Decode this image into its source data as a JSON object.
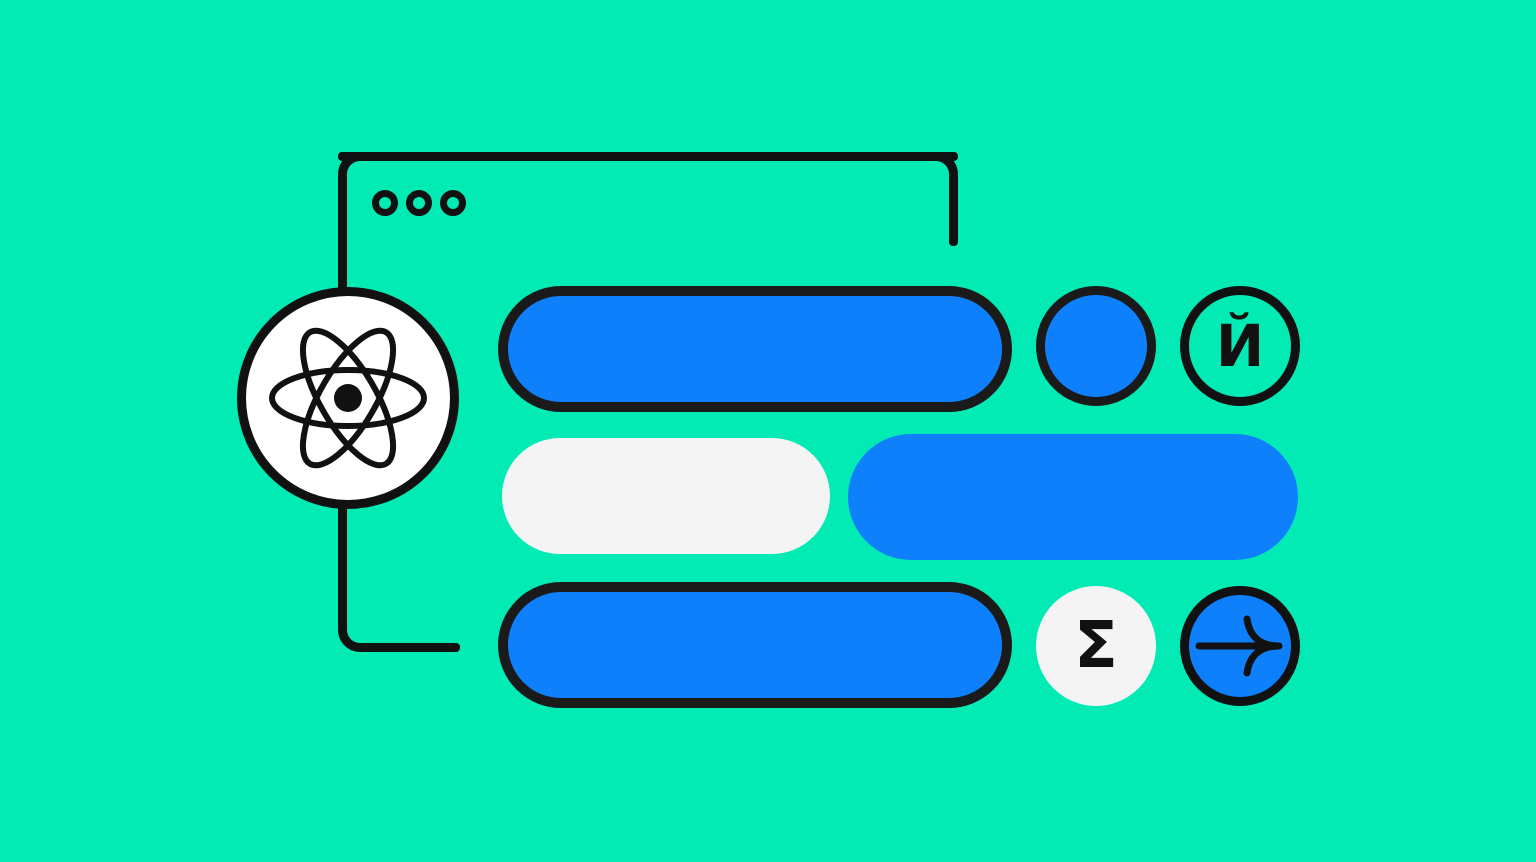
{
  "colors": {
    "background": "#02ebb5",
    "accent_blue": "#0e80fc",
    "light_gray": "#f4f4f4",
    "stroke": "#111111",
    "badge_white": "#ffffff"
  },
  "icons": {
    "window_dots": [
      "window-dot-icon",
      "window-dot-icon",
      "window-dot-icon"
    ],
    "logo": "react-atom-icon",
    "arrow": "arrow-right-icon"
  },
  "glyphs": {
    "cyrillic_letter": "Й",
    "sigma_letter": "Σ"
  }
}
